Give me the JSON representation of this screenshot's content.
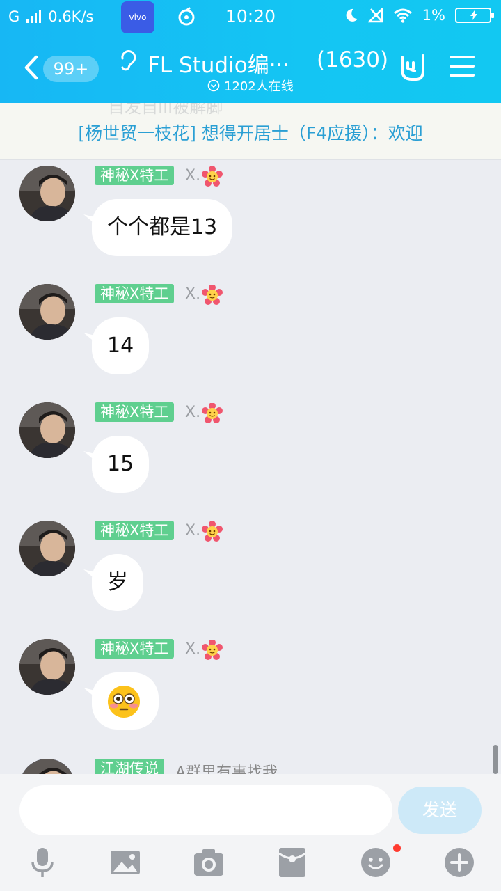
{
  "status_bar": {
    "network_label": "G",
    "speed": "0.6K/s",
    "vivo_label": "vivo",
    "time": "10:20",
    "battery": "1%"
  },
  "header": {
    "back_badge": "99+",
    "title": "FL Studio编···",
    "member_count": "(1630)",
    "online_text": "1202人在线"
  },
  "announcement": {
    "ghost_text": "自发自III被解脚",
    "text": "[杨世贸一枝花] 想得开居士（F4应援）：欢迎"
  },
  "messages": [
    {
      "tag": "神秘X特工",
      "nick": "X.",
      "text": "个个都是13"
    },
    {
      "tag": "神秘X特工",
      "nick": "X.",
      "text": "14"
    },
    {
      "tag": "神秘X特工",
      "nick": "X.",
      "text": "15"
    },
    {
      "tag": "神秘X特工",
      "nick": "X.",
      "text": "岁"
    },
    {
      "tag": "神秘X特工",
      "nick": "X.",
      "text": "",
      "emoji": "flushed-face"
    },
    {
      "tag": "江湖传说",
      "nick": "A群里有事找我",
      "text": ""
    }
  ],
  "composer": {
    "input_value": "",
    "send_label": "发送"
  },
  "toolbar": {
    "icons": [
      "microphone-icon",
      "image-icon",
      "camera-icon",
      "red-packet-icon",
      "emoji-icon",
      "plus-icon"
    ]
  },
  "colors": {
    "header": "#17b7f4",
    "tag_green": "#5fcf8f",
    "announce_text": "#2a9fd4",
    "send_button": "#cde9f8"
  }
}
